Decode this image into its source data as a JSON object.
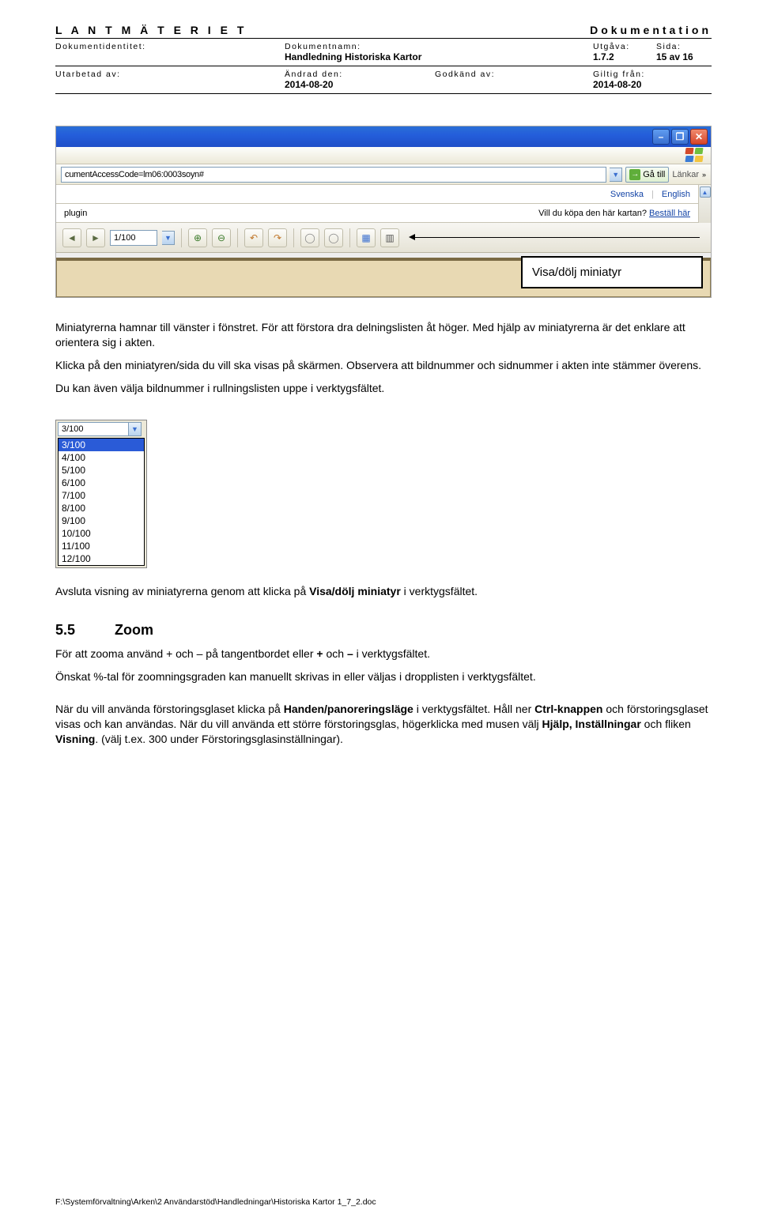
{
  "header": {
    "org": "L A N T M Ä T E R I E T",
    "doc_type": "Dokumentation",
    "row2": {
      "c1_label": "Dokumentidentitet:",
      "c2_label": "Dokumentnamn:",
      "c2_value": "Handledning Historiska Kartor",
      "c3_label": "Utgåva:",
      "c3_value": "1.7.2",
      "c4_label": "Sida:",
      "c4_value": "15 av 16"
    },
    "row3": {
      "c1_label": "Utarbetad av:",
      "c2_label": "Ändrad den:",
      "c2_value": "2014-08-20",
      "c3_label": "Godkänd av:",
      "c4_label": "Giltig från:",
      "c4_value": "2014-08-20"
    }
  },
  "browser": {
    "address_fragment": "cumentAccessCode=lm06:0003soyn#",
    "go_label": "Gå till",
    "links_label": "Länkar",
    "lang_sv": "Svenska",
    "lang_en": "English",
    "buy_prompt": "Vill du köpa den här kartan?",
    "buy_link": "Beställ här",
    "plugin_label": "plugin",
    "page_indicator": "1/100",
    "callout": "Visa/dölj miniatyr"
  },
  "body": {
    "p1": "Miniatyrerna hamnar till vänster i fönstret. För att förstora dra delningslisten åt höger. Med hjälp av miniatyrerna är det enklare att orientera sig i akten.",
    "p2": "Klicka på den miniatyren/sida du vill ska visas på skärmen. Observera att bildnummer och sidnummer i akten inte stämmer överens.",
    "p3": "Du kan även välja bildnummer i rullningslisten uppe i verktygsfältet.",
    "p4a": "Avsluta visning av miniatyrerna genom att klicka på ",
    "p4b": "Visa/dölj miniatyr",
    "p4c": " i verktygsfältet."
  },
  "dropdown": {
    "current": "3/100",
    "items": [
      "3/100",
      "4/100",
      "5/100",
      "6/100",
      "7/100",
      "8/100",
      "9/100",
      "10/100",
      "11/100",
      "12/100"
    ]
  },
  "zoom": {
    "num": "5.5",
    "title": "Zoom",
    "p1a": "För att zooma använd + och – på tangentbordet eller ",
    "p1b": "+",
    "p1c": " och ",
    "p1d": "–",
    "p1e": " i verktygsfältet.",
    "p2": "Önskat %-tal för zoomningsgraden kan manuellt skrivas in eller väljas i dropplisten i verktygsfältet.",
    "p3a": "När du vill använda förstoringsglaset klicka på ",
    "p3b": "Handen/panoreringsläge",
    "p3c": " i verktygsfältet. Håll ner ",
    "p3d": "Ctrl-knappen",
    "p3e": " och förstoringsglaset visas och kan användas. När du vill använda ett större förstoringsglas, högerklicka med musen välj ",
    "p3f": "Hjälp, Inställningar",
    "p3g": " och fliken ",
    "p3h": "Visning",
    "p3i": ". (välj t.ex. 300 under Förstoringsglasinställningar)."
  },
  "footer": "F:\\Systemförvaltning\\Arken\\2 Användarstöd\\Handledningar\\Historiska Kartor 1_7_2.doc"
}
